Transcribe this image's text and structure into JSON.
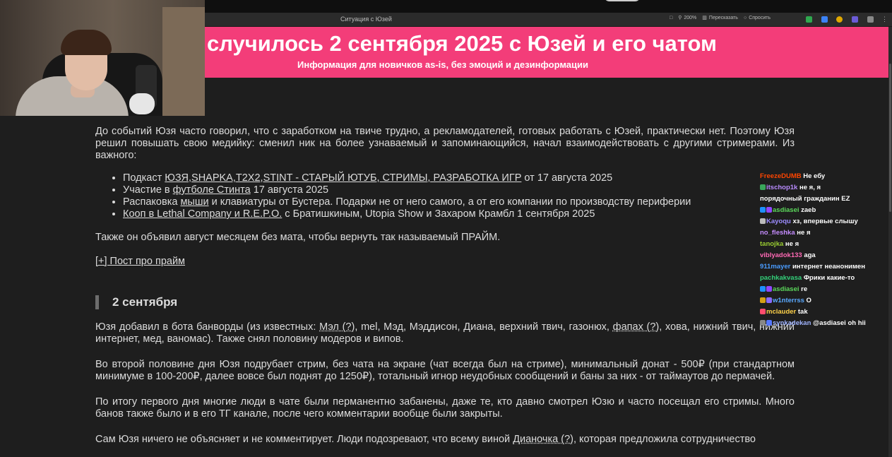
{
  "browser": {
    "tab_title": "Ситуация с Юзей",
    "zoom": "200%",
    "retell_label": "Пересказать",
    "ask_label": "Спросить"
  },
  "banner": {
    "title": "случилось 2 сентября 2025 с Юзей и его чатом",
    "subtitle": "Информация для новичков as-is, без эмоций и дезинформации",
    "color": "#f33d79"
  },
  "article": {
    "intro": "До событий Юзя часто говорил, что с заработком на твиче трудно, а рекламодателей, готовых работать с Юзей, практически нет. Поэтому Юзя решил повышать свою медийку: сменил ник на более узнаваемый и запоминающийся, начал взаимодействовать с другими стримерами. Из важного:",
    "list": [
      {
        "pre": "Подкаст ",
        "link": "ЮЗЯ,SHAPKA,T2X2,STINT - СТАРЫЙ ЮТУБ, СТРИМЫ, РАЗРАБОТКА ИГР",
        "post": " от 17 августа 2025"
      },
      {
        "pre": "Участие в ",
        "link": "футболе Стинта",
        "post": " 17 августа 2025"
      },
      {
        "pre": "Распаковка ",
        "link": "мыши",
        "post": " и клавиатуры от Бустера. Подарки не от него самого, а от его компании по производству периферии"
      },
      {
        "pre": "",
        "link": "Кооп в Lethal Company и R.E.P.O.",
        "post": " с Братишкиным, Utopia Show и Захаром Крамбл 1 сентября 2025"
      }
    ],
    "august": "Также он объявил август месяцем без мата, чтобы вернуть так называемый ПРАЙМ.",
    "prime_post_link": "[+] Пост про прайм",
    "section_heading": "2 сентября",
    "p1_pre": "Юзя добавил в бота банворды (из известных: ",
    "p1_l1": "Мэл (?)",
    "p1_mid": ", mel, Мэд, Мэддисон, Диана, верхний твич, газонюх, ",
    "p1_l2": "фапах (?)",
    "p1_post": ", хова, нижний твич, нижний интернет, мед, ваномас). Также снял половину модеров и випов.",
    "p2": "Во второй половине дня Юзя подрубает стрим, без чата на экране (чат всегда был на стриме), минимальный донат - 500₽ (при стандартном минимуме в 100-200₽, далее вовсе был поднят до 1250₽), тотальный игнор неудобных сообщений и баны за них - от таймаутов до пермачей.",
    "p3": "По итогу первого дня многие люди в чате были перманентно забанены, даже те, кто давно смотрел Юзю и часто посещал его стримы. Много банов также было и в его ТГ канале, после чего комментарии вообще были закрыты.",
    "p4_pre": "Сам Юзя ничего не объясняет и не комментирует. Люди подозревают, что всему виной ",
    "p4_link": "Дианочка (?)",
    "p4_post": ", которая предложила сотрудничество"
  },
  "chat": [
    {
      "user": "FreezeDUMB",
      "color": "#ff4500",
      "badges": [],
      "text": "Не ебу"
    },
    {
      "user": "itschop1k",
      "color": "#b98cff",
      "badges": [
        "#3aa65b"
      ],
      "text": "не я, я"
    },
    {
      "user": "",
      "color": "#ffffff",
      "badges": [],
      "text": "порядочный гражданин EZ"
    },
    {
      "user": "asdiasei",
      "color": "#5bd85b",
      "badges": [
        "#1e90ff",
        "#9147ff"
      ],
      "text": "zaeb"
    },
    {
      "user": "Kayoqu",
      "color": "#9c8cff",
      "badges": [
        "#bbbbbb"
      ],
      "text": "хз, впервые слышу"
    },
    {
      "user": "no_fleshka",
      "color": "#c58cff",
      "badges": [],
      "text": "не я"
    },
    {
      "user": "tanojka",
      "color": "#9acd32",
      "badges": [],
      "text": "не я"
    },
    {
      "user": "viblyadok133",
      "color": "#ff69b4",
      "badges": [],
      "text": "aga"
    },
    {
      "user": "911mayer",
      "color": "#4a9cff",
      "badges": [],
      "text": "интернет неанонимен"
    },
    {
      "user": "pachkakvasa",
      "color": "#33d17a",
      "badges": [],
      "text": "Фрики какие-то"
    },
    {
      "user": "asdiasei",
      "color": "#5bd85b",
      "badges": [
        "#1e90ff",
        "#9147ff"
      ],
      "text": "re"
    },
    {
      "user": "w1nterrss",
      "color": "#5aa9ff",
      "badges": [
        "#d4a017",
        "#8a6cff"
      ],
      "text": "O"
    },
    {
      "user": "mclauder",
      "color": "#ffd24a",
      "badges": [
        "#ff4d6d"
      ],
      "text": "tak"
    },
    {
      "user": "synkadekan",
      "color": "#a0b4ff",
      "badges": [
        "#888888",
        "#5577ff"
      ],
      "text": "@asdiasei oh hii"
    }
  ]
}
